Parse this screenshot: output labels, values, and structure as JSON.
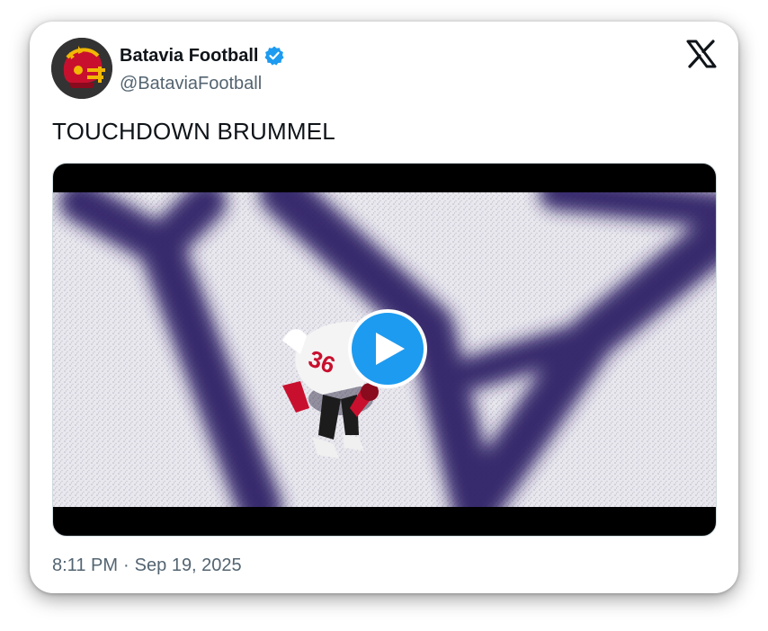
{
  "tweet": {
    "author": {
      "display_name": "Batavia Football",
      "handle": "@BataviaFootball",
      "verified": true,
      "avatar_icon": "helmet-avatar"
    },
    "text": "TOUCHDOWN BRUMMEL",
    "media": {
      "type": "video",
      "play_icon": "play-icon",
      "jersey_number": "36"
    },
    "time": "8:11 PM",
    "separator": "·",
    "date": "Sep 19, 2025"
  },
  "brand": {
    "logo": "x-logo"
  },
  "colors": {
    "accent": "#1d9bf0",
    "text_primary": "#0f1419",
    "text_secondary": "#536471",
    "field_shadow": "#2a1f63",
    "helmet_red": "#c8102e",
    "helmet_gold": "#f2b705"
  }
}
